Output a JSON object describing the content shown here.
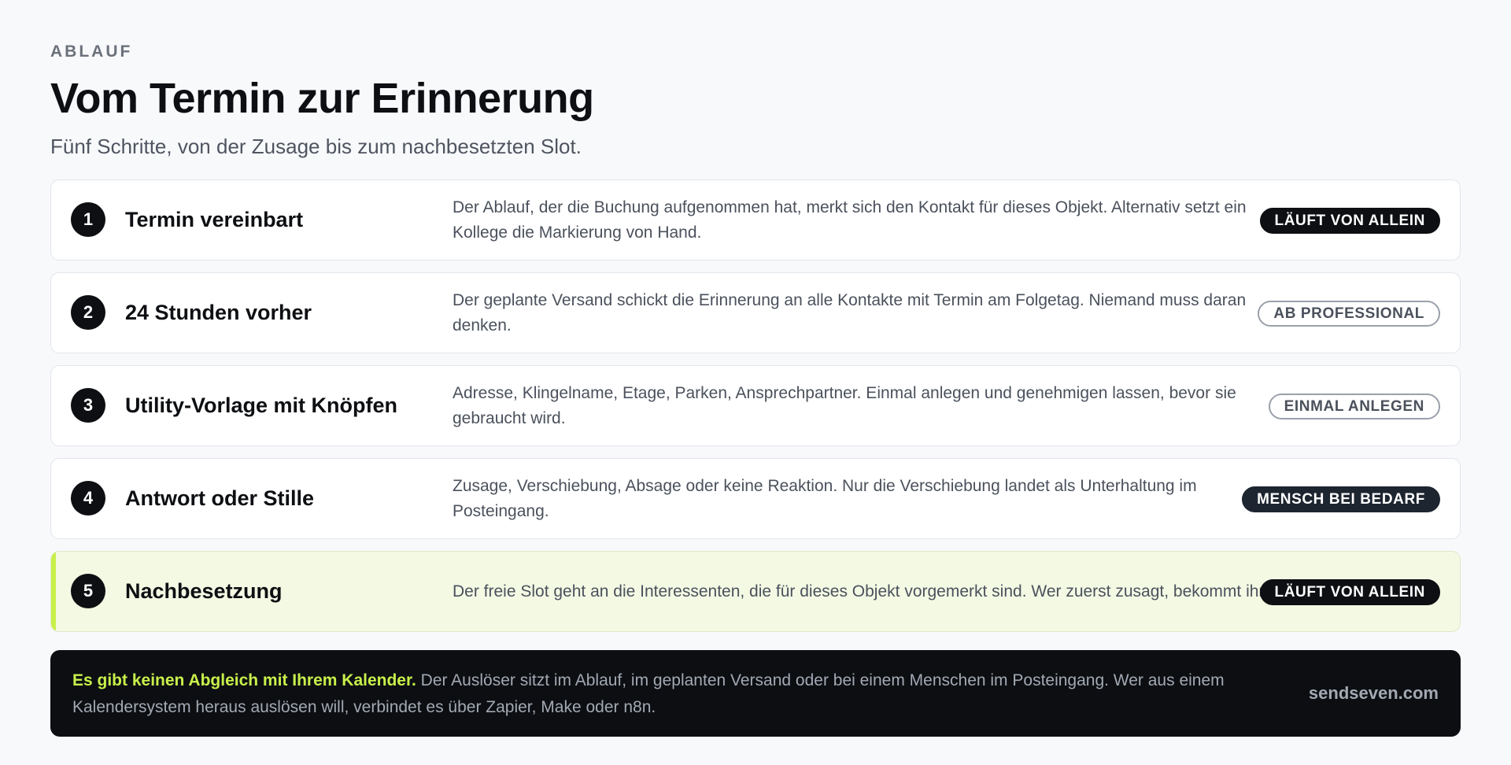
{
  "header": {
    "eyebrow": "ABLAUF",
    "title": "Vom Termin zur Erinnerung",
    "subtitle": "Fünf Schritte, von der Zusage bis zum nachbesetzten Slot."
  },
  "steps": [
    {
      "number": "1",
      "title": "Termin vereinbart",
      "description": "Der Ablauf, der die Buchung aufgenommen hat, merkt sich den Kontakt für dieses Objekt. Alternativ setzt ein Kollege die Markierung von Hand.",
      "badge": "LÄUFT VON ALLEIN"
    },
    {
      "number": "2",
      "title": "24 Stunden vorher",
      "description": "Der geplante Versand schickt die Erinnerung an alle Kontakte mit Termin am Folgetag. Niemand muss daran denken.",
      "badge": "AB PROFESSIONAL"
    },
    {
      "number": "3",
      "title": "Utility-Vorlage mit Knöpfen",
      "description": "Adresse, Klingelname, Etage, Parken, Ansprechpartner. Einmal anlegen und genehmigen lassen, bevor sie gebraucht wird.",
      "badge": "EINMAL ANLEGEN"
    },
    {
      "number": "4",
      "title": "Antwort oder Stille",
      "description": "Zusage, Verschiebung, Absage oder keine Reaktion. Nur die Verschiebung landet als Unterhaltung im Posteingang.",
      "badge": "MENSCH BEI BEDARF"
    },
    {
      "number": "5",
      "title": "Nachbesetzung",
      "description": "Der freie Slot geht an die Interessenten, die für dieses Objekt vorgemerkt sind. Wer zuerst zusagt, bekommt ihn.",
      "badge": "LÄUFT VON ALLEIN"
    }
  ],
  "note": {
    "strong": "Es gibt keinen Abgleich mit Ihrem Kalender.",
    "text": " Der Auslöser sitzt im Ablauf, im geplanten Versand oder bei einem Menschen im Posteingang. Wer aus einem Kalendersystem heraus auslösen will, verbindet es über Zapier, Make oder n8n.",
    "brand": "sendseven.com"
  },
  "colors": {
    "accent": "#c8f04a",
    "highlight_background": "#f4f9e4",
    "dark": "#0d0f12"
  }
}
